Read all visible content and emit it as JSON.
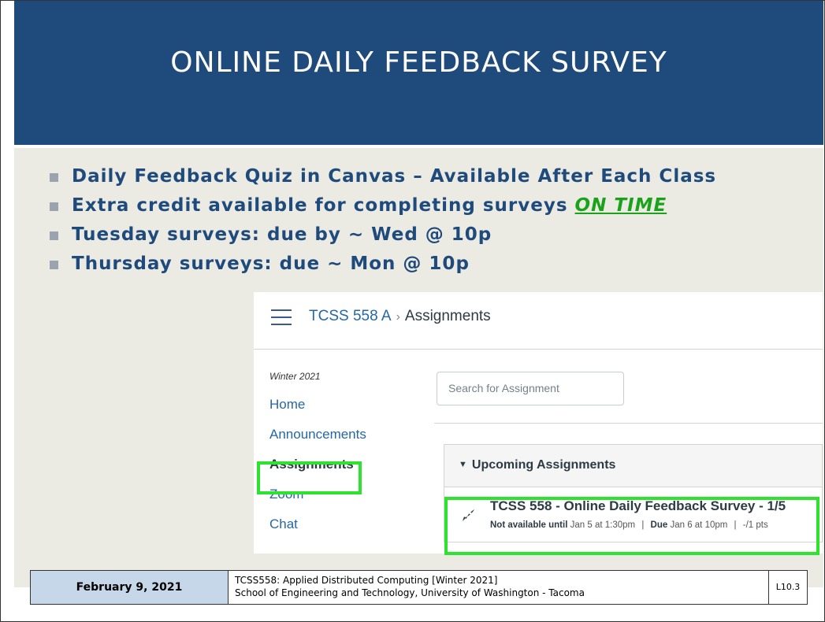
{
  "slide": {
    "title": "ONLINE DAILY FEEDBACK SURVEY",
    "bullets": [
      "Daily Feedback Quiz in Canvas – Available After Each Class",
      "Extra credit available for completing surveys ",
      "Tuesday surveys: due by ~ Wed @ 10p",
      "Thursday surveys: due ~ Mon @ 10p"
    ],
    "emphasis": "ON TIME"
  },
  "canvas": {
    "breadcrumb": {
      "course": "TCSS 558 A",
      "separator": "›",
      "page": "Assignments"
    },
    "term": "Winter 2021",
    "nav": [
      {
        "label": "Home"
      },
      {
        "label": "Announcements"
      },
      {
        "label": "Assignments"
      },
      {
        "label": "Zoom"
      },
      {
        "label": "Chat"
      }
    ],
    "search_placeholder": "Search for Assignment",
    "section_label": "Upcoming Assignments",
    "assignment": {
      "title": "TCSS 558 - Online Daily Feedback Survey - 1/5",
      "not_available_label": "Not available until",
      "not_available_value": "Jan 5 at 1:30pm",
      "due_label": "Due",
      "due_value": "Jan 6 at 10pm",
      "points": "-/1 pts",
      "sep": "|"
    }
  },
  "footer": {
    "date": "February 9, 2021",
    "course_line1": "TCSS558: Applied Distributed Computing [Winter 2021]",
    "course_line2": "School of Engineering and Technology, University of Washington - Tacoma",
    "slide_number": "L10.3"
  },
  "colors": {
    "title_band": "#1f4a7c",
    "bullet_text": "#1f4a7c",
    "highlight": "#2ee32e",
    "on_time": "#1aa21a",
    "footer_date_bg": "#c5d7e8"
  }
}
